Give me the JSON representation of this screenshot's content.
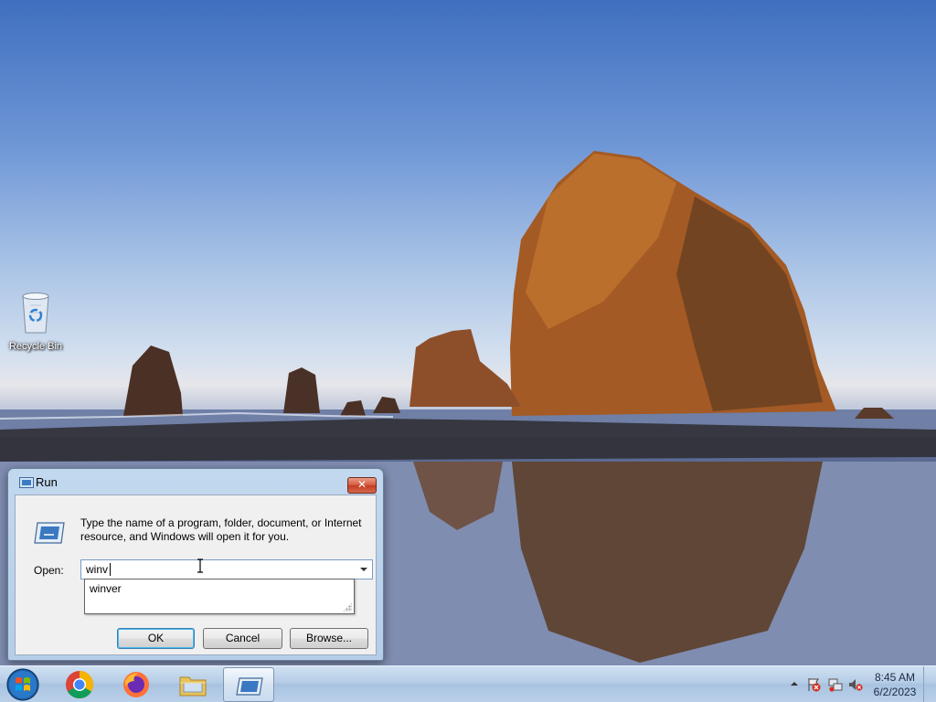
{
  "desktop": {
    "icons": [
      {
        "label": "Recycle Bin",
        "icon": "recycle-bin-icon"
      }
    ]
  },
  "run_dialog": {
    "title": "Run",
    "description": "Type the name of a program, folder, document, or Internet resource, and Windows will open it for you.",
    "open_label": "Open:",
    "input_value": "winv",
    "suggestions": [
      "winver"
    ],
    "buttons": {
      "ok": "OK",
      "cancel": "Cancel",
      "browse": "Browse..."
    },
    "close_glyph": "✕"
  },
  "taskbar": {
    "start": "start-orb-icon",
    "pinned": [
      "chrome-icon",
      "firefox-icon",
      "file-explorer-icon",
      "run-icon"
    ],
    "active_item": "run-icon",
    "tray": {
      "icons": [
        "show-hidden-icons-icon",
        "action-center-icon",
        "network-icon",
        "volume-muted-icon"
      ],
      "time": "8:45 AM",
      "date": "6/2/2023"
    }
  },
  "colors": {
    "taskbar": "#b9d0e9",
    "dialog_frame": "#b5cde9",
    "dialog_client": "#f0f0f0",
    "close_button": "#c9462a",
    "default_button_border": "#3c7fb1"
  }
}
